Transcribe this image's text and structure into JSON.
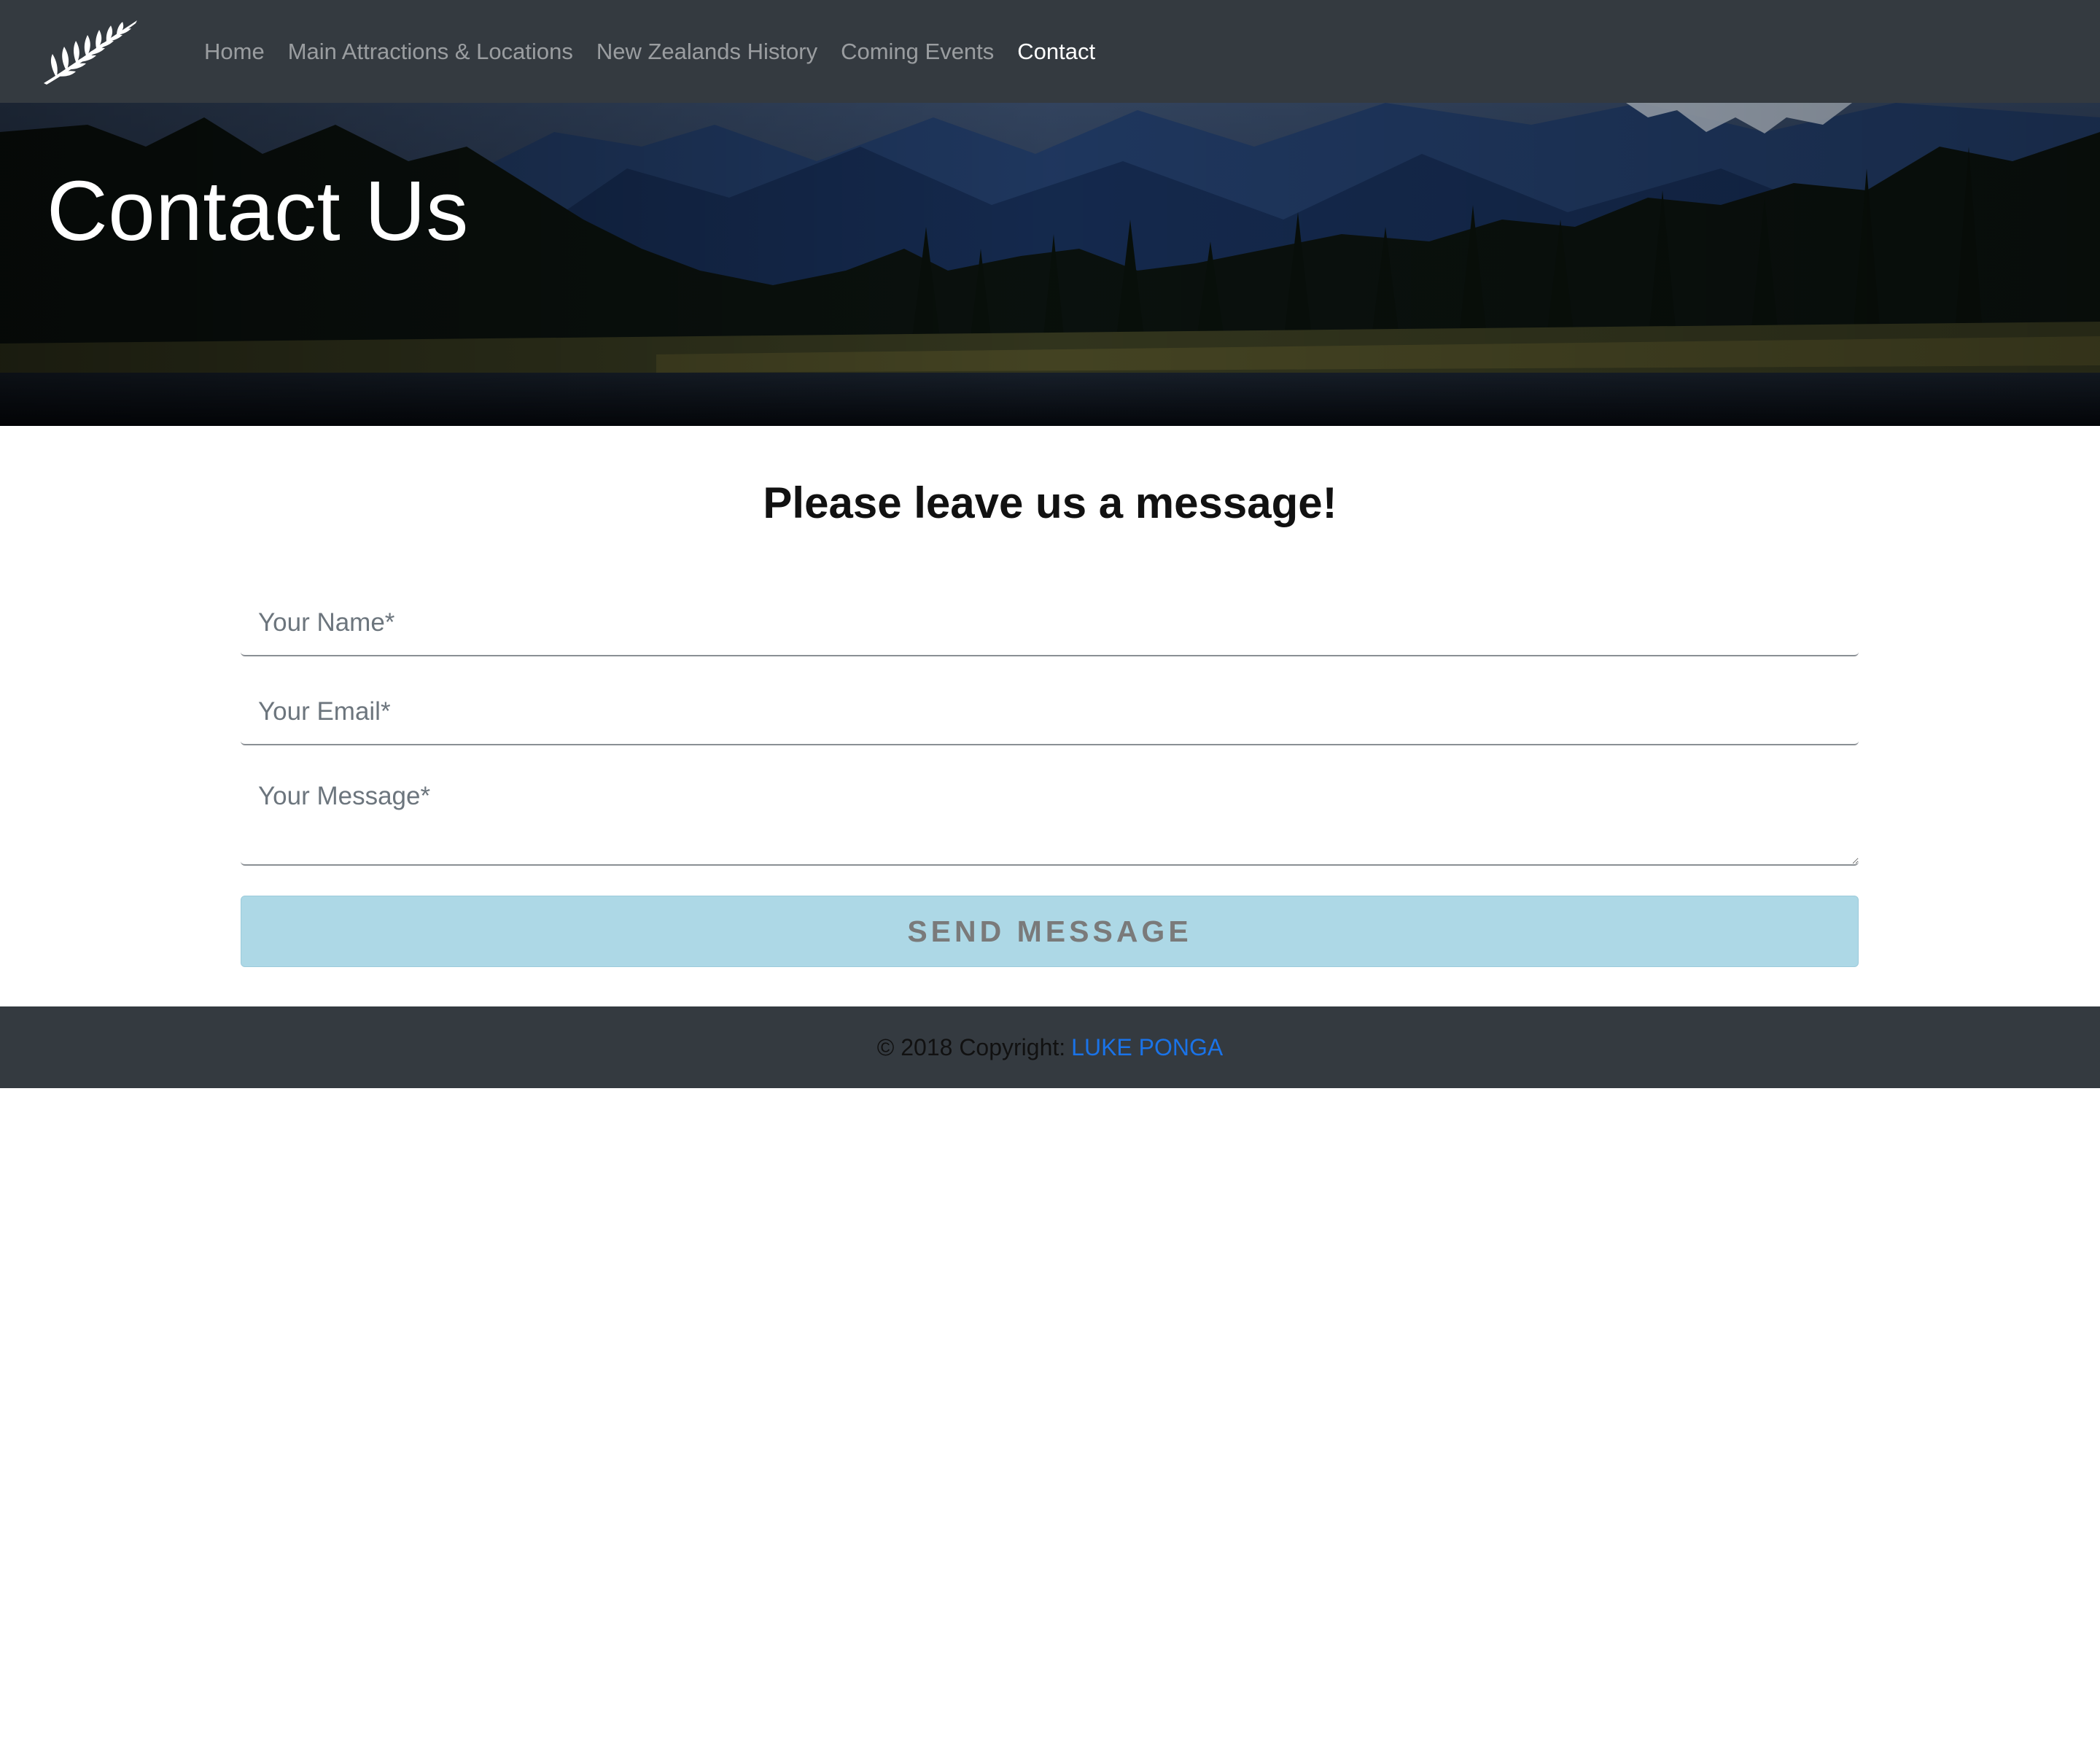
{
  "nav": {
    "logo_icon": "silver-fern-icon",
    "items": [
      {
        "label": "Home",
        "active": false
      },
      {
        "label": "Main Attractions & Locations",
        "active": false
      },
      {
        "label": "New Zealands History",
        "active": false
      },
      {
        "label": "Coming Events",
        "active": false
      },
      {
        "label": "Contact",
        "active": true
      }
    ]
  },
  "hero": {
    "title": "Contact Us"
  },
  "form": {
    "heading": "Please leave us a message!",
    "name_placeholder": "Your Name*",
    "email_placeholder": "Your Email*",
    "message_placeholder": "Your Message*",
    "submit_label": "SEND MESSAGE"
  },
  "footer": {
    "copyright": "© 2018 Copyright:",
    "author_link": "LUKE PONGA"
  },
  "colors": {
    "navbar_bg": "#343a40",
    "button_bg": "#add8e6",
    "link": "#1a73e8"
  }
}
